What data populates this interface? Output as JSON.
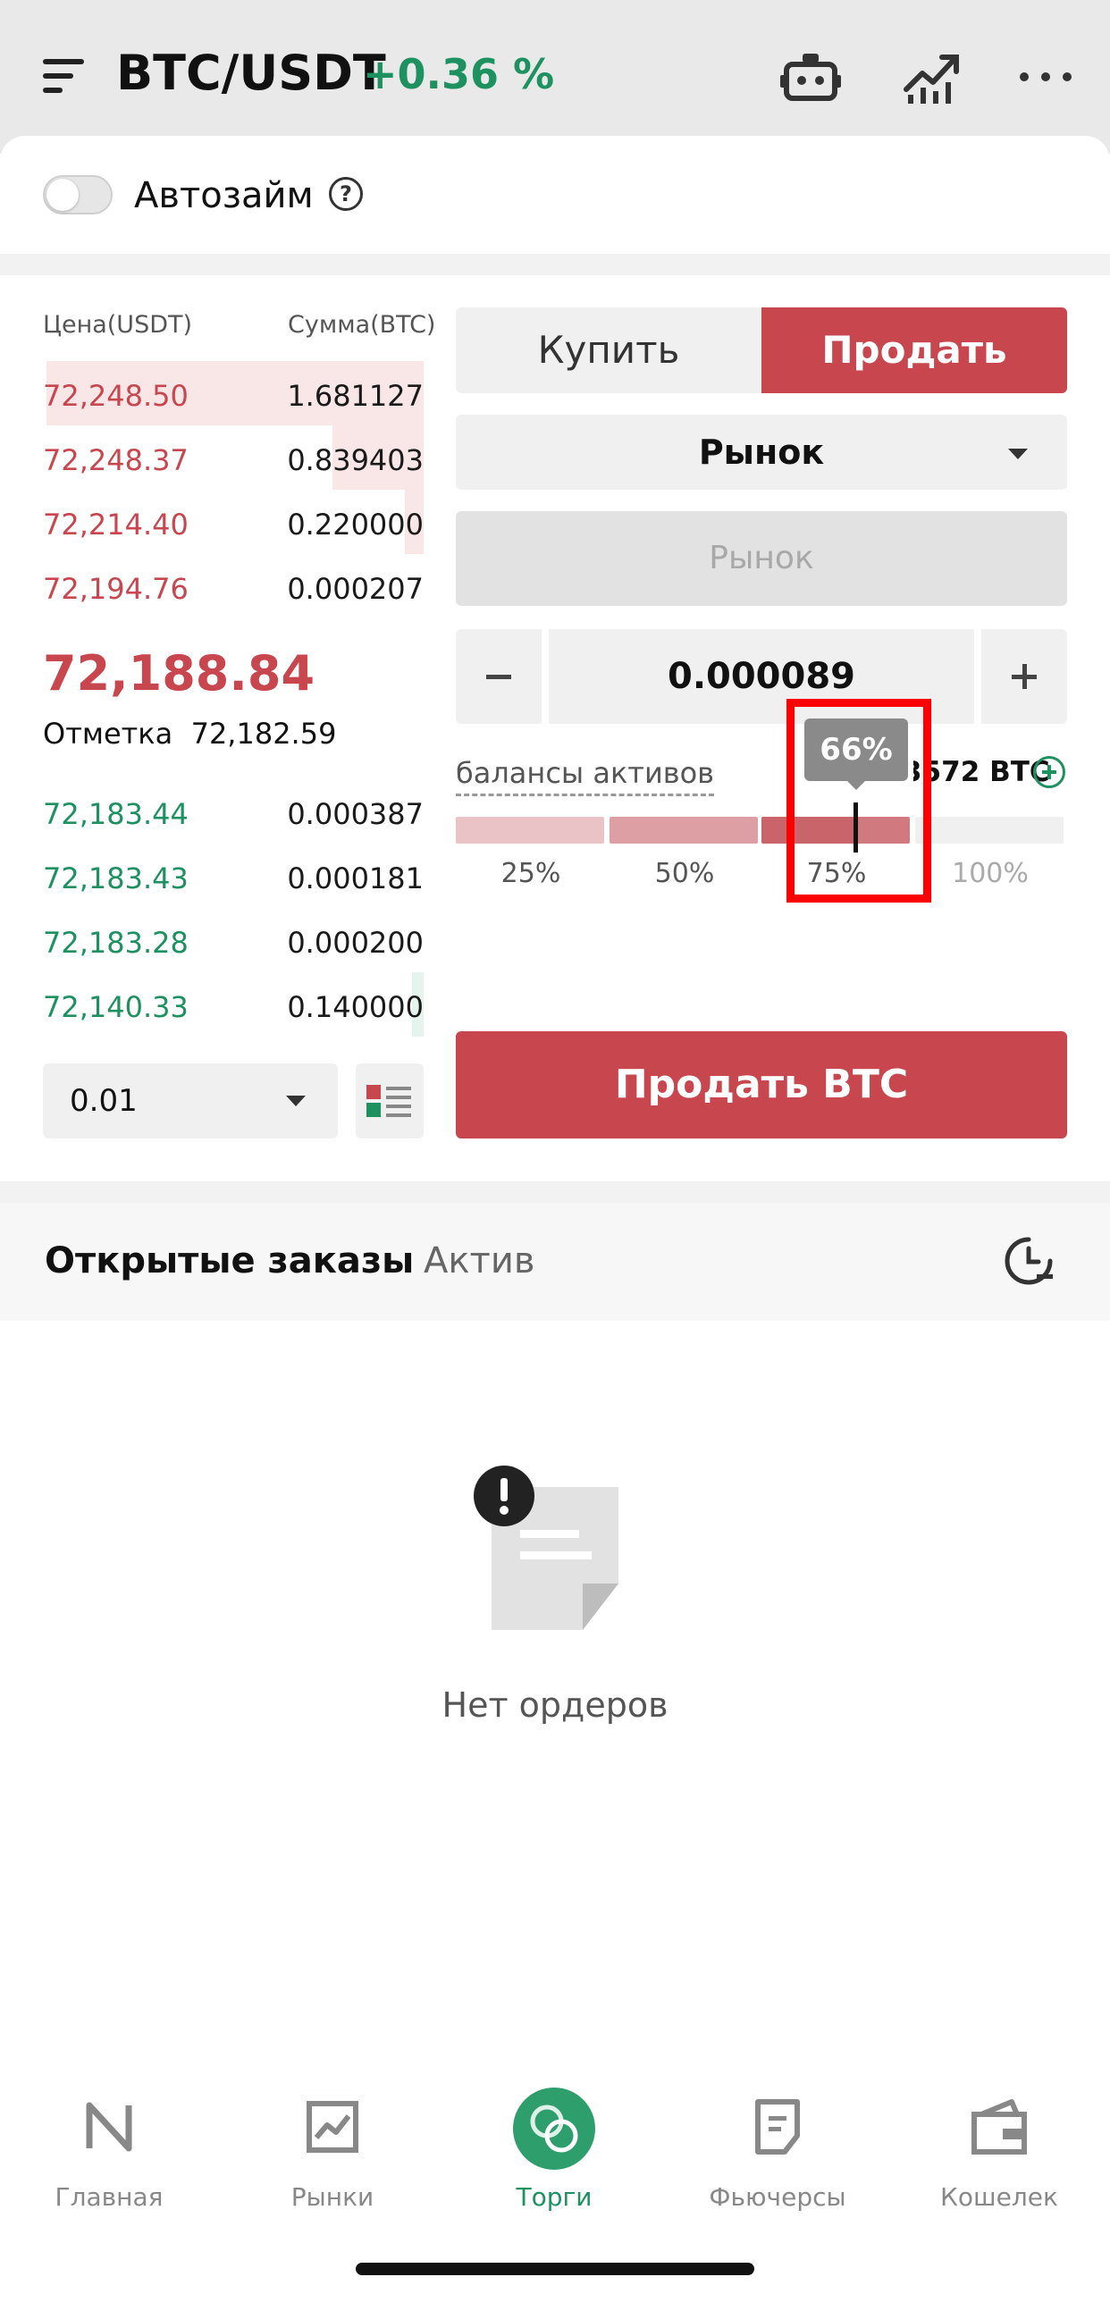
{
  "header": {
    "pair": "BTC/USDT",
    "change": "+0.36 %",
    "icons": [
      "menu-icon",
      "robot-icon",
      "chart-icon",
      "more-icon"
    ]
  },
  "autoloan": {
    "label": "Автозайм",
    "help": "?",
    "enabled": false
  },
  "orderbook": {
    "price_header": "Цена(USDT)",
    "amount_header": "Сумма(BTC)",
    "asks": [
      {
        "price": "72,248.50",
        "amount": "1.681127",
        "depth": 0.99
      },
      {
        "price": "72,248.37",
        "amount": "0.839403",
        "depth": 0.24
      },
      {
        "price": "72,214.40",
        "amount": "0.220000",
        "depth": 0.05
      },
      {
        "price": "72,194.76",
        "amount": "0.000207",
        "depth": 0.0
      }
    ],
    "last_price": "72,188.84",
    "mark_label": "Отметка",
    "mark_price": "72,182.59",
    "bids": [
      {
        "price": "72,183.44",
        "amount": "0.000387",
        "depth": 0.0
      },
      {
        "price": "72,183.43",
        "amount": "0.000181",
        "depth": 0.0
      },
      {
        "price": "72,183.28",
        "amount": "0.000200",
        "depth": 0.0
      },
      {
        "price": "72,140.33",
        "amount": "0.140000",
        "depth": 0.03
      }
    ],
    "depth_step": "0.01"
  },
  "trade": {
    "buy_label": "Купить",
    "sell_label": "Продать",
    "order_type": "Рынок",
    "price_placeholder": "Рынок",
    "quantity": "0.000089",
    "balance_label": "балансы активов",
    "balance_value": "3572 BTC",
    "slider_percent": 66,
    "tooltip": "66%",
    "marks": [
      "25%",
      "50%",
      "75%",
      "100%"
    ],
    "submit_label": "Продать BTC"
  },
  "orders": {
    "tab_open": "Открытые заказы",
    "tab_asset": "Актив",
    "empty": "Нет ордеров"
  },
  "nav": [
    {
      "label": "Главная",
      "icon": "home-icon",
      "active": false
    },
    {
      "label": "Рынки",
      "icon": "markets-icon",
      "active": false
    },
    {
      "label": "Торги",
      "icon": "trade-icon",
      "active": true
    },
    {
      "label": "Фьючерсы",
      "icon": "futures-icon",
      "active": false
    },
    {
      "label": "Кошелек",
      "icon": "wallet-icon",
      "active": false
    }
  ],
  "colors": {
    "sell": "#c8464e",
    "buy": "#1e9161",
    "ask_depth": "#f9e6e7",
    "bid_depth": "#e6f4ee",
    "highlight": "#ff0000"
  }
}
